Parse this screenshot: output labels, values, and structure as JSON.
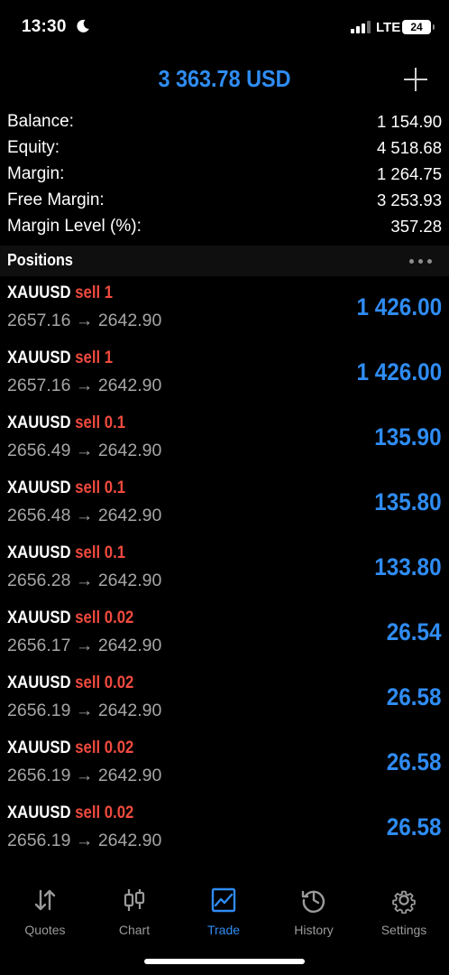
{
  "status_bar": {
    "time": "13:30",
    "network": "LTE",
    "battery": "24"
  },
  "header": {
    "title": "3 363.78 USD",
    "add_icon": "plus-icon"
  },
  "summary": [
    {
      "label": "Balance:",
      "value": "1 154.90"
    },
    {
      "label": "Equity:",
      "value": "4 518.68"
    },
    {
      "label": "Margin:",
      "value": "1 264.75"
    },
    {
      "label": "Free Margin:",
      "value": "3 253.93"
    },
    {
      "label": "Margin Level (%):",
      "value": "357.28"
    }
  ],
  "positions_header": {
    "title": "Positions",
    "more_icon": "more-dots-icon"
  },
  "positions": [
    {
      "symbol": "XAUUSD",
      "side": "sell 1",
      "prices": "2657.16 → 2642.90",
      "profit": "1 426.00"
    },
    {
      "symbol": "XAUUSD",
      "side": "sell 1",
      "prices": "2657.16 → 2642.90",
      "profit": "1 426.00"
    },
    {
      "symbol": "XAUUSD",
      "side": "sell 0.1",
      "prices": "2656.49 → 2642.90",
      "profit": "135.90"
    },
    {
      "symbol": "XAUUSD",
      "side": "sell 0.1",
      "prices": "2656.48 → 2642.90",
      "profit": "135.80"
    },
    {
      "symbol": "XAUUSD",
      "side": "sell 0.1",
      "prices": "2656.28 → 2642.90",
      "profit": "133.80"
    },
    {
      "symbol": "XAUUSD",
      "side": "sell 0.02",
      "prices": "2656.17 → 2642.90",
      "profit": "26.54"
    },
    {
      "symbol": "XAUUSD",
      "side": "sell 0.02",
      "prices": "2656.19 → 2642.90",
      "profit": "26.58"
    },
    {
      "symbol": "XAUUSD",
      "side": "sell 0.02",
      "prices": "2656.19 → 2642.90",
      "profit": "26.58"
    },
    {
      "symbol": "XAUUSD",
      "side": "sell 0.02",
      "prices": "2656.19 → 2642.90",
      "profit": "26.58"
    }
  ],
  "tabs": [
    {
      "label": "Quotes",
      "icon": "quotes-arrows-icon",
      "active": false
    },
    {
      "label": "Chart",
      "icon": "candlestick-icon",
      "active": false
    },
    {
      "label": "Trade",
      "icon": "trade-chart-icon",
      "active": true
    },
    {
      "label": "History",
      "icon": "history-clock-icon",
      "active": false
    },
    {
      "label": "Settings",
      "icon": "gear-icon",
      "active": false
    }
  ],
  "colors": {
    "accent_blue": "#2f8cf3",
    "sell_red": "#f04a3e",
    "muted_gray": "#a6a6a6",
    "background": "#000000"
  }
}
